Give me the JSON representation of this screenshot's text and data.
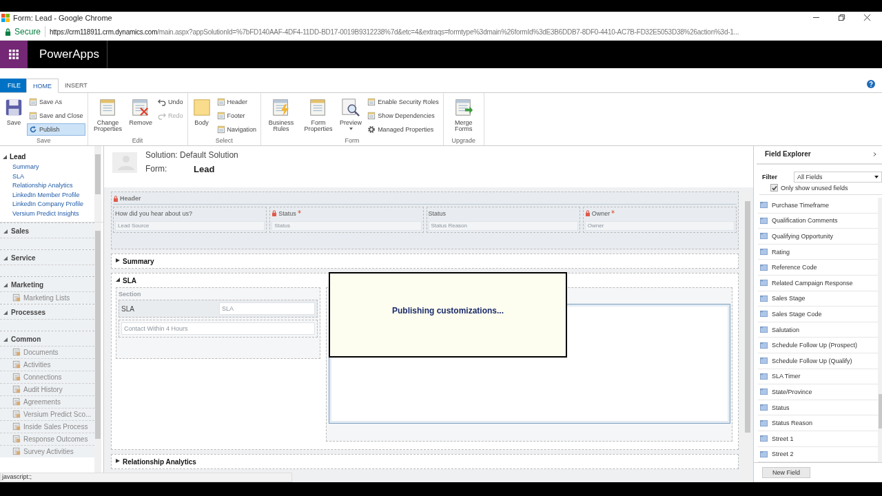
{
  "window": {
    "title": "Form: Lead - Google Chrome"
  },
  "address": {
    "secure_label": "Secure",
    "url_host": "https://crm118911.crm.dynamics.com",
    "url_rest": "/main.aspx?appSolutionId=%7bFD140AAF-4DF4-11DD-BD17-0019B9312238%7d&etc=4&extraqs=formtype%3dmain%26formId%3dE3B6DDB7-8DF0-4410-AC7B-FD32E5053D38%26action%3d-1..."
  },
  "app": {
    "name": "PowerApps"
  },
  "ribbon_tabs": [
    {
      "label": "FILE",
      "kind": "file",
      "selected": false
    },
    {
      "label": "HOME",
      "kind": "tab",
      "selected": true
    },
    {
      "label": "INSERT",
      "kind": "tab",
      "selected": false
    }
  ],
  "ribbon_groups": [
    {
      "label": "Save",
      "items": [
        {
          "kind": "large",
          "label": "Save",
          "disabled": false,
          "highlighted": false
        },
        {
          "kind": "small",
          "label": "Save As",
          "disabled": false,
          "highlighted": false
        },
        {
          "kind": "small",
          "label": "Save and Close",
          "disabled": false,
          "highlighted": false
        },
        {
          "kind": "small",
          "label": "Publish",
          "disabled": false,
          "highlighted": true
        }
      ]
    },
    {
      "label": "Edit",
      "items": [
        {
          "kind": "large",
          "label": "Change Properties",
          "disabled": false,
          "highlighted": false
        },
        {
          "kind": "large",
          "label": "Remove",
          "disabled": false,
          "highlighted": false
        },
        {
          "kind": "small",
          "label": "Undo",
          "disabled": false,
          "highlighted": false
        },
        {
          "kind": "small",
          "label": "Redo",
          "disabled": true,
          "highlighted": false
        }
      ]
    },
    {
      "label": "Select",
      "items": [
        {
          "kind": "large",
          "label": "Body",
          "disabled": false,
          "highlighted": false
        },
        {
          "kind": "small",
          "label": "Header",
          "disabled": false,
          "highlighted": false
        },
        {
          "kind": "small",
          "label": "Footer",
          "disabled": false,
          "highlighted": false
        },
        {
          "kind": "small",
          "label": "Navigation",
          "disabled": false,
          "highlighted": false
        }
      ]
    },
    {
      "label": "Form",
      "items": [
        {
          "kind": "large",
          "label": "Business Rules",
          "disabled": false,
          "highlighted": false
        },
        {
          "kind": "large",
          "label": "Form Properties",
          "disabled": false,
          "highlighted": false
        },
        {
          "kind": "dropdown",
          "label": "Preview",
          "disabled": false,
          "highlighted": false
        },
        {
          "kind": "small",
          "label": "Enable Security Roles",
          "disabled": false,
          "highlighted": false
        },
        {
          "kind": "small",
          "label": "Show Dependencies",
          "disabled": false,
          "highlighted": false
        },
        {
          "kind": "small",
          "label": "Managed Properties",
          "disabled": false,
          "highlighted": false
        }
      ]
    },
    {
      "label": "Upgrade",
      "items": [
        {
          "kind": "large",
          "label": "Merge Forms",
          "disabled": false,
          "highlighted": false
        }
      ]
    }
  ],
  "nav_tree": {
    "label": "Lead",
    "expanded": true,
    "children": [
      {
        "label": "Summary"
      },
      {
        "label": "SLA"
      },
      {
        "label": "Relationship Analytics"
      },
      {
        "label": "LinkedIn Member Profile"
      },
      {
        "label": "LinkedIn Company Profile"
      },
      {
        "label": "Versium Predict Insights"
      }
    ]
  },
  "nav_sections": [
    {
      "title": "Sales",
      "expanded": true
    },
    {
      "title": "Service",
      "expanded": true
    },
    {
      "title": "Marketing",
      "expanded": true,
      "items": [
        "Marketing Lists"
      ]
    },
    {
      "title": "Processes",
      "expanded": true
    },
    {
      "title": "Common",
      "expanded": true,
      "items": [
        "Documents",
        "Activities",
        "Connections",
        "Audit History",
        "Agreements",
        "Versium Predict Sco...",
        "Inside Sales Process",
        "Response Outcomes",
        "Survey Activities"
      ]
    }
  ],
  "form": {
    "solution": "Solution: Default Solution",
    "form_label": "Form:",
    "form_name": "Lead"
  },
  "header": {
    "title": "Header",
    "locked": true,
    "fields": [
      {
        "label": "How did you hear about us?",
        "placeholder": "Lead Source",
        "locked": false,
        "required": false
      },
      {
        "label": "Status",
        "placeholder": "Status",
        "locked": true,
        "required": true
      },
      {
        "label": "Status",
        "placeholder": "Status Reason",
        "locked": false,
        "required": false
      },
      {
        "label": "Owner",
        "placeholder": "Owner",
        "locked": true,
        "required": true
      }
    ]
  },
  "form_tabs": [
    {
      "title": "Summary",
      "expanded": false
    },
    {
      "title": "SLA",
      "expanded": true,
      "section": {
        "label": "Section",
        "field_label": "SLA",
        "field_placeholder": "SLA",
        "wide_placeholder": "Contact Within 4 Hours"
      }
    },
    {
      "title": "Relationship Analytics",
      "expanded": false
    }
  ],
  "dialog": {
    "message": "Publishing customizations..."
  },
  "field_explorer": {
    "title": "Field Explorer",
    "filter_label": "Filter",
    "filter_value": "All Fields",
    "unused_only": {
      "label": "Only show unused fields",
      "checked": true
    },
    "fields": [
      "Purchase Timeframe",
      "Qualification Comments",
      "Qualifying Opportunity",
      "Rating",
      "Reference Code",
      "Related Campaign Response",
      "Sales Stage",
      "Sales Stage Code",
      "Salutation",
      "Schedule Follow Up (Prospect)",
      "Schedule Follow Up (Qualify)",
      "SLA Timer",
      "State/Province",
      "Status",
      "Status Reason",
      "Street 1",
      "Street 2"
    ],
    "new_button": "New Field"
  },
  "status_bar": "javascript:;"
}
